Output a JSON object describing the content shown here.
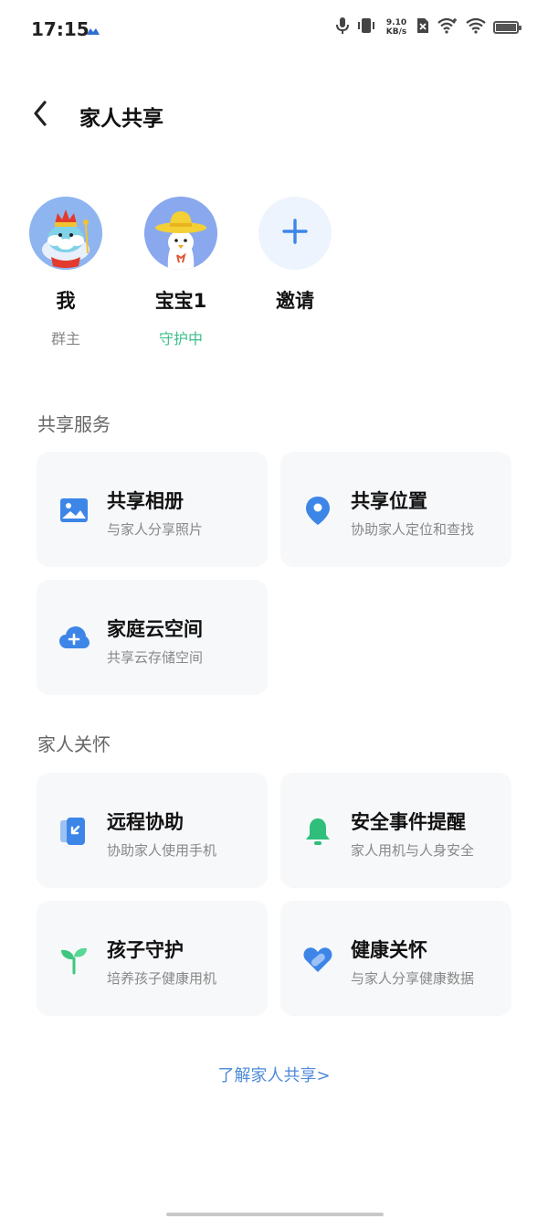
{
  "status_bar": {
    "time": "17:15",
    "network_speed_value": "9.10",
    "network_speed_unit": "KB/s",
    "icons": [
      "app-notification-icon",
      "mic-icon",
      "vibrate-icon",
      "speed-indicator",
      "no-sim-icon",
      "wifi-plus-icon",
      "wifi-icon",
      "battery-icon"
    ]
  },
  "header": {
    "title": "家人共享",
    "back_icon": "chevron-left-icon"
  },
  "members": [
    {
      "name": "我",
      "role": "群主"
    },
    {
      "name": "宝宝1",
      "role": "守护中"
    }
  ],
  "invite": {
    "label": "邀请",
    "icon": "plus-icon"
  },
  "shared_services": {
    "title": "共享服务",
    "items": [
      {
        "title": "共享相册",
        "subtitle": "与家人分享照片",
        "icon": "photo-album-icon",
        "color": "#3d86e8"
      },
      {
        "title": "共享位置",
        "subtitle": "协助家人定位和查找",
        "icon": "location-pin-icon",
        "color": "#3d86e8"
      },
      {
        "title": "家庭云空间",
        "subtitle": "共享云存储空间",
        "icon": "cloud-plus-icon",
        "color": "#3d86e8"
      }
    ]
  },
  "family_care": {
    "title": "家人关怀",
    "items": [
      {
        "title": "远程协助",
        "subtitle": "协助家人使用手机",
        "icon": "remote-assist-icon",
        "color": "#3d86e8"
      },
      {
        "title": "安全事件提醒",
        "subtitle": "家人用机与人身安全",
        "icon": "bell-icon",
        "color": "#2fbf7a"
      },
      {
        "title": "孩子守护",
        "subtitle": "培养孩子健康用机",
        "icon": "sprout-icon",
        "color": "#3cc77e"
      },
      {
        "title": "健康关怀",
        "subtitle": "与家人分享健康数据",
        "icon": "health-heart-icon",
        "color": "#3d86e8"
      }
    ]
  },
  "learn_more": "了解家人共享>",
  "colors": {
    "accent": "#3d86e8",
    "guard_green": "#3cbf8a",
    "card_bg": "#f7f8fa",
    "link": "#4d8ad8"
  }
}
